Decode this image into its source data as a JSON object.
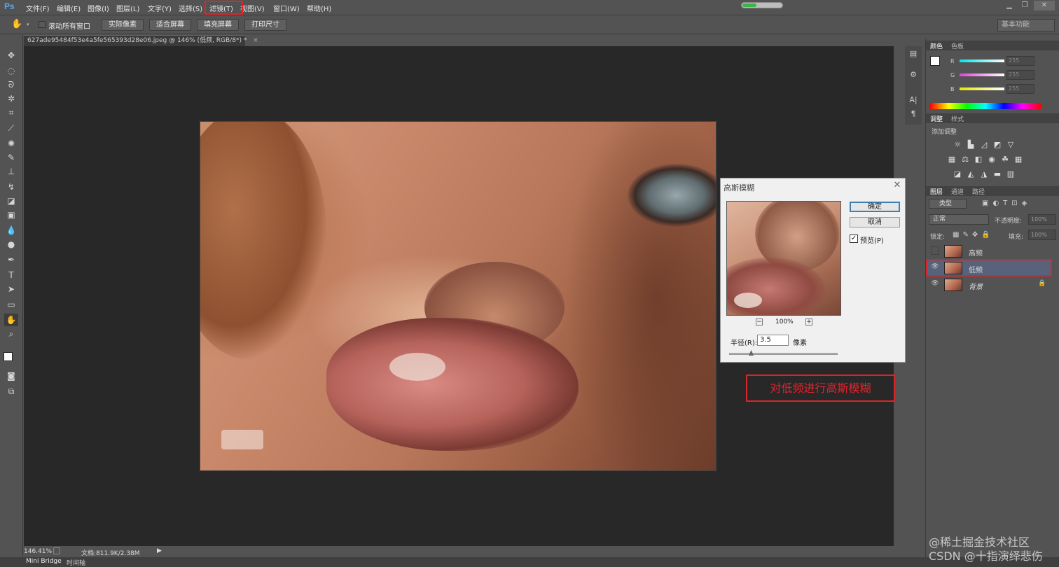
{
  "app": {
    "logo": "Ps"
  },
  "menu": [
    "文件(F)",
    "编辑(E)",
    "图像(I)",
    "图层(L)",
    "文字(Y)",
    "选择(S)",
    "滤镜(T)",
    "视图(V)",
    "窗口(W)",
    "帮助(H)"
  ],
  "menu_highlight": "滤镜(T)",
  "progress": {
    "fill_percent": 35,
    "color": "#39b54a"
  },
  "options": {
    "scroll_all_label": "滚动所有窗口",
    "actual_pixels": "实际像素",
    "fit_screen": "适合屏幕",
    "fill_screen": "填充屏幕",
    "print_size": "打印尺寸",
    "workspace": "基本功能"
  },
  "document": {
    "tab_title": "627ade95484f53e4a5fe565393d28e06.jpeg @ 146% (低频, RGB/8*) *"
  },
  "dialog": {
    "title": "高斯模糊",
    "ok": "确定",
    "cancel": "取消",
    "preview_label": "预览(P)",
    "preview_checked": "✓",
    "zoom": "100%",
    "zoom_out": "−",
    "zoom_in": "+",
    "radius_label": "半径(R):",
    "radius_value": "3.5",
    "radius_unit": "像素",
    "radius_fraction": 0.2
  },
  "annotation": "对低频进行高斯模糊",
  "panels": {
    "color_tabs": [
      "颜色",
      "色板"
    ],
    "rgb": [
      {
        "label": "R",
        "value": "255",
        "color": "#00e5e5"
      },
      {
        "label": "G",
        "value": "255",
        "color": "#e040e0"
      },
      {
        "label": "B",
        "value": "255",
        "color": "#e6e600"
      }
    ],
    "adjust_tabs": [
      "调整",
      "样式"
    ],
    "add_adjustment": "添加调整",
    "layer_tabs": [
      "图层",
      "通道",
      "路径"
    ],
    "kind": "类型",
    "blend_mode": "正常",
    "opacity_label": "不透明度:",
    "opacity_value": "100%",
    "lock_label": "锁定:",
    "fill_label": "填充:",
    "fill_value": "100%",
    "layers": [
      {
        "name": "高频",
        "visible": false
      },
      {
        "name": "低频",
        "visible": true
      },
      {
        "name": "背景",
        "visible": true
      }
    ]
  },
  "status": {
    "zoom": "146.41%",
    "doc": "文档:811.9K/2.38M"
  },
  "bottom_tabs": [
    "Mini Bridge",
    "时间轴"
  ],
  "watermark": {
    "line1": "@稀土掘金技术社区",
    "line2": "CSDN @十指演绎悲伤"
  }
}
